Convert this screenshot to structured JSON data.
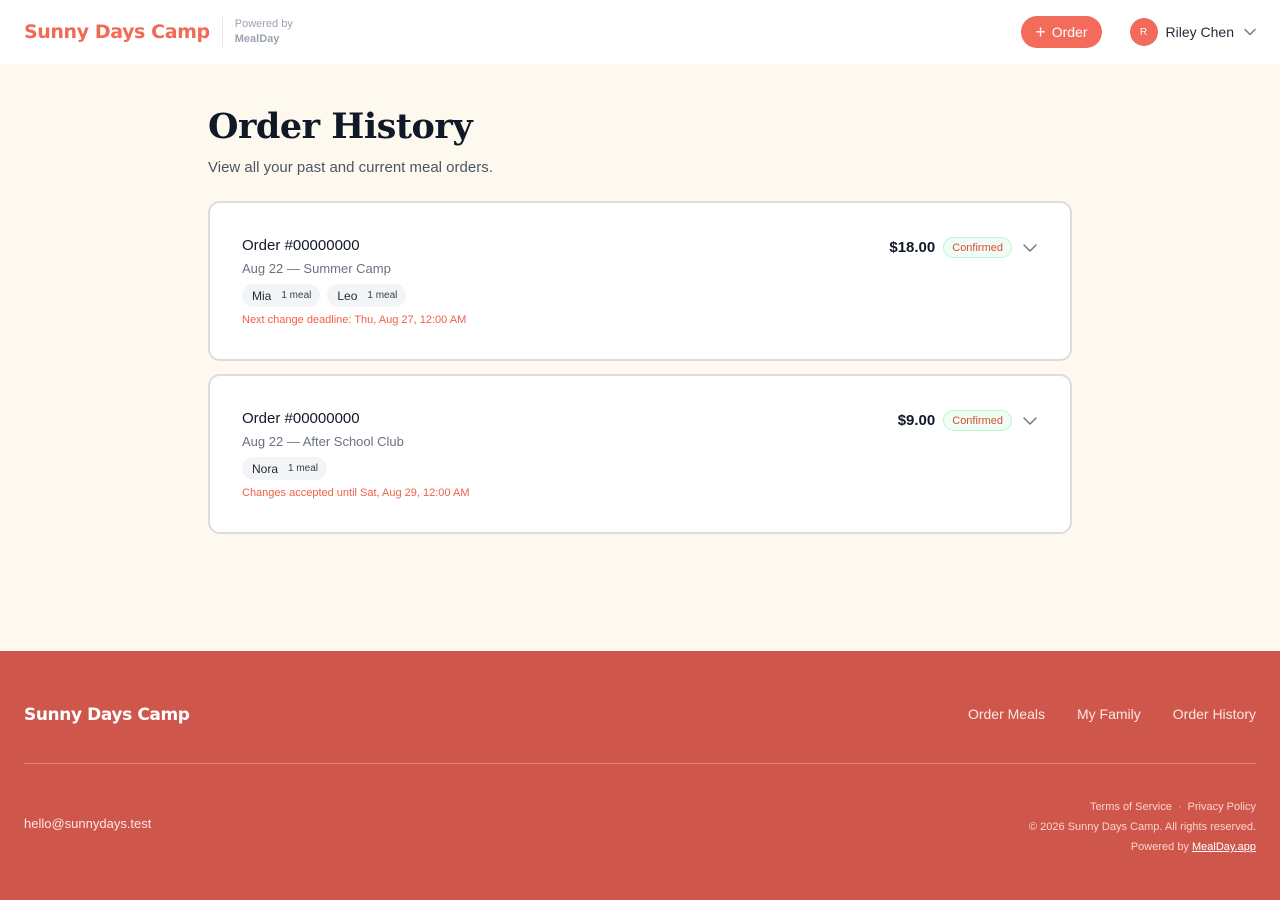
{
  "header": {
    "brand": "Sunny Days Camp",
    "powered_by_label": "Powered by",
    "powered_by_brand": "MealDay",
    "order_button_label": "Order",
    "user": {
      "initial": "R",
      "name": "Riley Chen"
    }
  },
  "page": {
    "title": "Order History",
    "subtitle": "View all your past and current meal orders."
  },
  "orders": [
    {
      "number": "Order #00000000",
      "meta": "Aug 22 — Summer Camp",
      "price": "$18.00",
      "status": "Confirmed",
      "children": [
        {
          "name": "Mia",
          "count": "1 meal"
        },
        {
          "name": "Leo",
          "count": "1 meal"
        }
      ],
      "deadline": "Next change deadline: Thu, Aug 27, 12:00 AM"
    },
    {
      "number": "Order #00000000",
      "meta": "Aug 22 — After School Club",
      "price": "$9.00",
      "status": "Confirmed",
      "children": [
        {
          "name": "Nora",
          "count": "1 meal"
        }
      ],
      "deadline": "Changes accepted until Sat, Aug 29, 12:00 AM"
    }
  ],
  "footer": {
    "brand": "Sunny Days Camp",
    "nav": [
      "Order Meals",
      "My Family",
      "Order History"
    ],
    "email": "hello@sunnydays.test",
    "terms": "Terms of Service",
    "privacy": "Privacy Policy",
    "copyright": "© 2026 Sunny Days Camp. All rights reserved.",
    "powered_by_label": "Powered by",
    "powered_by_link": "MealDay.app"
  },
  "colors": {
    "accent": "#f26b5b",
    "background": "#fdf9ef",
    "footer": "#ce564b",
    "status_badge_border": "#bbf7d0"
  },
  "icons": [
    "plus-icon",
    "chevron-down-icon"
  ]
}
